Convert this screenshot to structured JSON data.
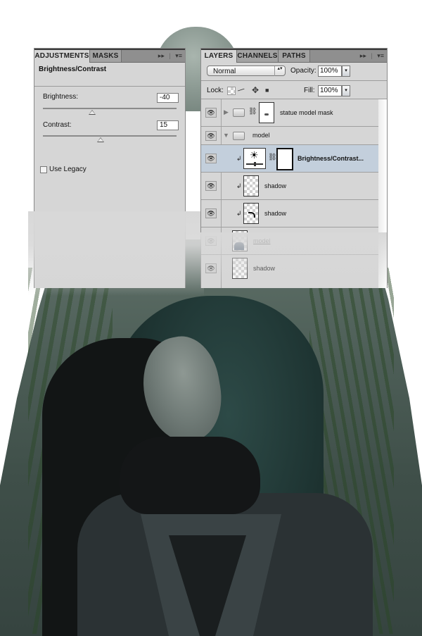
{
  "adjustments_panel": {
    "tabs": [
      {
        "label": "ADJUSTMENTS",
        "active": true
      },
      {
        "label": "MASKS",
        "active": false
      }
    ],
    "collapse_icon": "double-arrow-icon",
    "menu_icon": "panel-menu-icon",
    "title": "Brightness/Contrast",
    "brightness": {
      "label": "Brightness:",
      "value": "-40",
      "slider_value": -40,
      "slider_range": [
        -150,
        150
      ]
    },
    "contrast": {
      "label": "Contrast:",
      "value": "15",
      "slider_value": 15,
      "slider_range": [
        -50,
        100
      ]
    },
    "use_legacy": {
      "label": "Use Legacy",
      "checked": false
    }
  },
  "layers_panel": {
    "tabs": [
      {
        "label": "LAYERS",
        "active": true
      },
      {
        "label": "CHANNELS",
        "active": false
      },
      {
        "label": "PATHS",
        "active": false
      }
    ],
    "blend_mode": "Normal",
    "opacity_label": "Opacity:",
    "opacity_value": "100%",
    "lock_label": "Lock:",
    "lock_icons": [
      "lock-transparency-icon",
      "lock-paint-icon",
      "lock-move-icon",
      "lock-all-icon"
    ],
    "fill_label": "Fill:",
    "fill_value": "100%",
    "layers": [
      {
        "name": "statue model mask",
        "type": "group",
        "expanded": false,
        "visible": true,
        "has_mask": true
      },
      {
        "name": "model",
        "type": "group",
        "expanded": true,
        "visible": true
      },
      {
        "name": "Brightness/Contrast...",
        "type": "adjustment",
        "selected": true,
        "clipped": true,
        "visible": true,
        "has_mask": true
      },
      {
        "name": "shadow",
        "type": "pixel",
        "clipped": true,
        "visible": true
      },
      {
        "name": "shadow",
        "type": "pixel",
        "clipped": true,
        "visible": true
      },
      {
        "name": "model",
        "type": "pixel",
        "visible": true,
        "underlined": true
      },
      {
        "name": "shadow",
        "type": "pixel",
        "visible": true
      }
    ]
  },
  "glyphs": {
    "eye": "👁",
    "tri_right": "▶",
    "tri_down": "▼",
    "chain": "🔗",
    "clip_arrow": "↲",
    "ffwd": "▸▸",
    "menu": "▾≡",
    "updown": "▴▾",
    "down": "▾",
    "move": "✥",
    "brush": "⁄",
    "padlock": "■",
    "sun": "☀"
  },
  "colors": {
    "panel_bg": "#d6d6d6",
    "tabbar_bg": "#8f8f8f",
    "selected_row": "#c3cfdc"
  }
}
